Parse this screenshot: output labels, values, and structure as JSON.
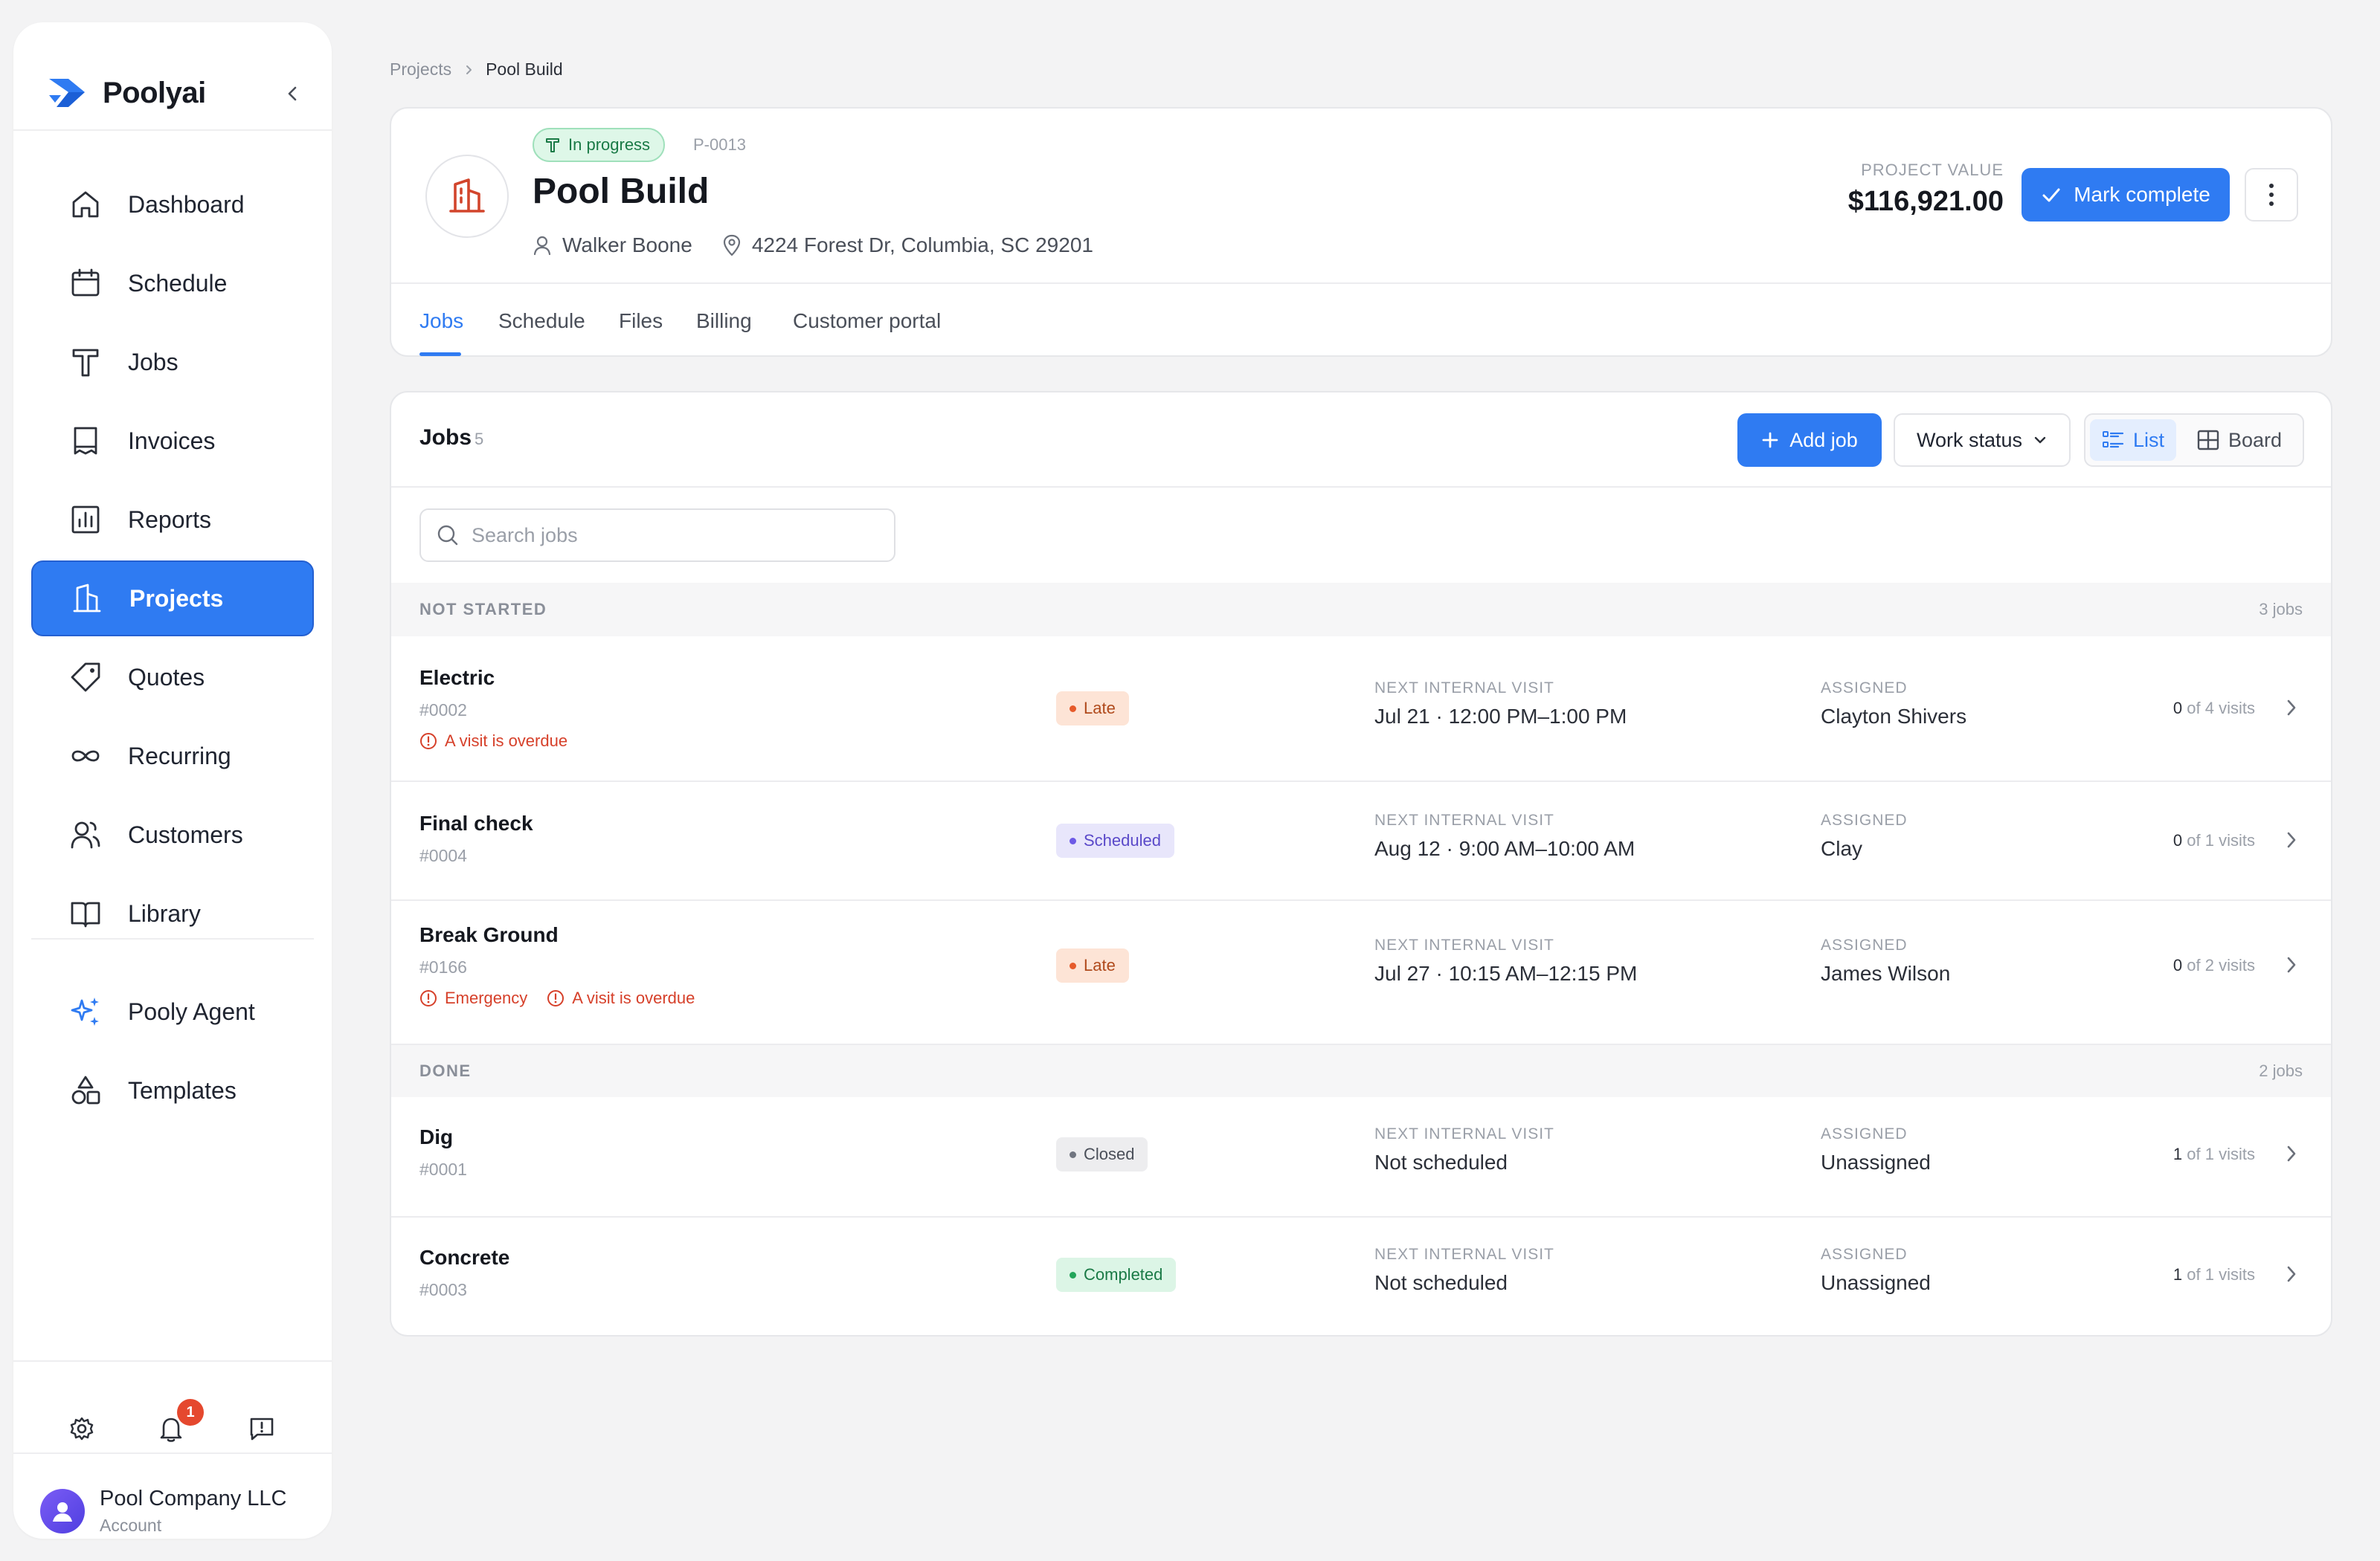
{
  "app": {
    "name": "Poolyai"
  },
  "sidebar": {
    "items": [
      {
        "label": "Dashboard",
        "icon": "home-icon"
      },
      {
        "label": "Schedule",
        "icon": "calendar-icon"
      },
      {
        "label": "Jobs",
        "icon": "tool-icon"
      },
      {
        "label": "Invoices",
        "icon": "invoice-icon"
      },
      {
        "label": "Reports",
        "icon": "bar-chart-icon"
      },
      {
        "label": "Projects",
        "icon": "building-icon",
        "active": true
      },
      {
        "label": "Quotes",
        "icon": "tag-icon"
      },
      {
        "label": "Recurring",
        "icon": "infinity-icon"
      },
      {
        "label": "Customers",
        "icon": "users-icon"
      },
      {
        "label": "Library",
        "icon": "book-icon"
      }
    ],
    "secondary_items": [
      {
        "label": "Pooly Agent",
        "icon": "sparkles-icon"
      },
      {
        "label": "Templates",
        "icon": "shapes-icon"
      }
    ],
    "notification_count": "1",
    "account": {
      "name": "Pool Company LLC",
      "subtitle": "Account"
    },
    "accent_color": "#2f7bf2"
  },
  "breadcrumb": {
    "parent": "Projects",
    "current": "Pool Build"
  },
  "project": {
    "status": "In progress",
    "code": "P-0013",
    "title": "Pool Build",
    "customer": "Walker Boone",
    "address": "4224 Forest Dr, Columbia, SC 29201",
    "value_label": "PROJECT VALUE",
    "value": "$116,921.00",
    "mark_complete_label": "Mark complete"
  },
  "tabs": [
    {
      "label": "Jobs",
      "active": true
    },
    {
      "label": "Schedule"
    },
    {
      "label": "Files"
    },
    {
      "label": "Billing"
    },
    {
      "label": "Customer portal"
    }
  ],
  "jobs": {
    "title": "Jobs",
    "count": "5",
    "add_label": "Add job",
    "filter_label": "Work status",
    "view_list": "List",
    "view_board": "Board",
    "search_placeholder": "Search jobs",
    "visit_label": "NEXT INTERNAL VISIT",
    "assigned_label": "ASSIGNED",
    "groups": [
      {
        "label": "NOT STARTED",
        "count": "3 jobs",
        "rows": [
          {
            "name": "Electric",
            "number": "#0002",
            "alerts": [
              "A visit is overdue"
            ],
            "status": "Late",
            "visit": "Jul 21 · 12:00 PM–1:00 PM",
            "assigned": "Clayton Shivers",
            "visits_done": "0",
            "visits_total": "of 4 visits"
          },
          {
            "name": "Final check",
            "number": "#0004",
            "alerts": [],
            "status": "Scheduled",
            "visit": "Aug 12 · 9:00 AM–10:00 AM",
            "assigned": "Clay",
            "visits_done": "0",
            "visits_total": "of 1 visits"
          },
          {
            "name": "Break Ground",
            "number": "#0166",
            "alerts": [
              "Emergency",
              "A visit is overdue"
            ],
            "status": "Late",
            "visit": "Jul 27 · 10:15 AM–12:15 PM",
            "assigned": "James Wilson",
            "visits_done": "0",
            "visits_total": "of 2 visits"
          }
        ]
      },
      {
        "label": "DONE",
        "count": "2 jobs",
        "rows": [
          {
            "name": "Dig",
            "number": "#0001",
            "alerts": [],
            "status": "Closed",
            "visit": "Not scheduled",
            "assigned": "Unassigned",
            "visits_done": "1",
            "visits_total": "of 1 visits"
          },
          {
            "name": "Concrete",
            "number": "#0003",
            "alerts": [],
            "status": "Completed",
            "visit": "Not scheduled",
            "assigned": "Unassigned",
            "visits_done": "1",
            "visits_total": "of 1 visits"
          }
        ]
      }
    ]
  }
}
